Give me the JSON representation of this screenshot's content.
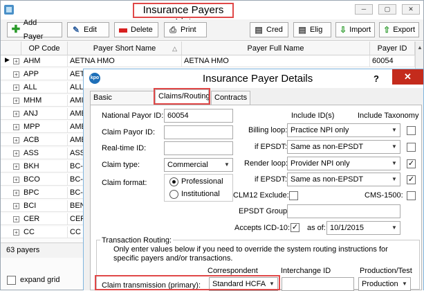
{
  "window": {
    "title": "Insurance Payers List",
    "controls": [
      "─",
      "▢",
      "✕"
    ]
  },
  "toolbar": {
    "add_payer": "Add Payer",
    "edit": "Edit",
    "delete": "Delete",
    "print": "Print",
    "cred": "Cred",
    "elig": "Elig",
    "import": "Import",
    "export": "Export"
  },
  "grid": {
    "columns": [
      "OP Code",
      "Payer Short Name",
      "Payer Full Name",
      "Payer ID"
    ],
    "sort_indicator": "△",
    "rows": [
      {
        "op": "AHM",
        "short": "AETNA HMO",
        "full": "AETNA HMO",
        "id": "60054"
      },
      {
        "op": "APP",
        "short": "AET",
        "full": "",
        "id": ""
      },
      {
        "op": "ALL",
        "short": "ALL",
        "full": "",
        "id": ""
      },
      {
        "op": "MHM",
        "short": "AMI",
        "full": "",
        "id": ""
      },
      {
        "op": "ANJ",
        "short": "AME",
        "full": "",
        "id": ""
      },
      {
        "op": "MPP",
        "short": "AME",
        "full": "",
        "id": ""
      },
      {
        "op": "ACB",
        "short": "AME",
        "full": "",
        "id": ""
      },
      {
        "op": "ASS",
        "short": "ASS",
        "full": "",
        "id": ""
      },
      {
        "op": "BKH",
        "short": "BC-",
        "full": "",
        "id": ""
      },
      {
        "op": "BCO",
        "short": "BC-",
        "full": "",
        "id": ""
      },
      {
        "op": "BPC",
        "short": "BC-",
        "full": "",
        "id": ""
      },
      {
        "op": "BCI",
        "short": "BEN",
        "full": "",
        "id": ""
      },
      {
        "op": "CER",
        "short": "CEF",
        "full": "",
        "id": ""
      },
      {
        "op": "CC",
        "short": "CC",
        "full": "",
        "id": ""
      }
    ]
  },
  "status": {
    "count": "63 payers",
    "expand_grid": "expand grid"
  },
  "dialog": {
    "title": "Insurance Payer Details",
    "logo": "kpo",
    "help": "?",
    "close": "✕",
    "tabs": [
      "Basic Information",
      "Claims/Routing",
      "Contracts"
    ],
    "national_payor_id_label": "National Payor ID:",
    "national_payor_id": "60054",
    "claim_payor_id_label": "Claim Payor ID:",
    "claim_payor_id": "",
    "realtime_id_label": "Real-time ID:",
    "realtime_id": "",
    "claim_type_label": "Claim type:",
    "claim_type": "Commercial",
    "claim_format_label": "Claim format:",
    "professional": "Professional",
    "institutional": "Institutional",
    "include_ids_label": "Include ID(s)",
    "include_taxonomy_label": "Include Taxonomy",
    "billing_loop_label": "Billing loop:",
    "billing_loop": "Practice NPI only",
    "if_epsdt_label": "if EPSDT:",
    "if_epsdt_1": "Same as non-EPSDT",
    "render_loop_label": "Render loop:",
    "render_loop": "Provider NPI only",
    "if_epsdt_2": "Same as non-EPSDT",
    "clm12_label": "CLM12 Exclude:",
    "cms1500_label": "CMS-1500:",
    "epsdt_group_label": "EPSDT Group:",
    "epsdt_group": "",
    "accepts_icd10_label": "Accepts ICD-10:",
    "as_of_label": "as of:",
    "as_of_date": "10/1/2015",
    "transaction_routing_label": "Transaction Routing:",
    "routing_note": "Only enter values below if you need to override the system routing instructions for specific payers and/or transactions.",
    "correspondent_label": "Correspondent",
    "interchange_id_label": "Interchange ID",
    "production_test_label": "Production/Test",
    "claim_transmission_label": "Claim transmission (primary):",
    "correspondent": "Standard HCFA",
    "interchange_id": "",
    "production": "Production"
  }
}
